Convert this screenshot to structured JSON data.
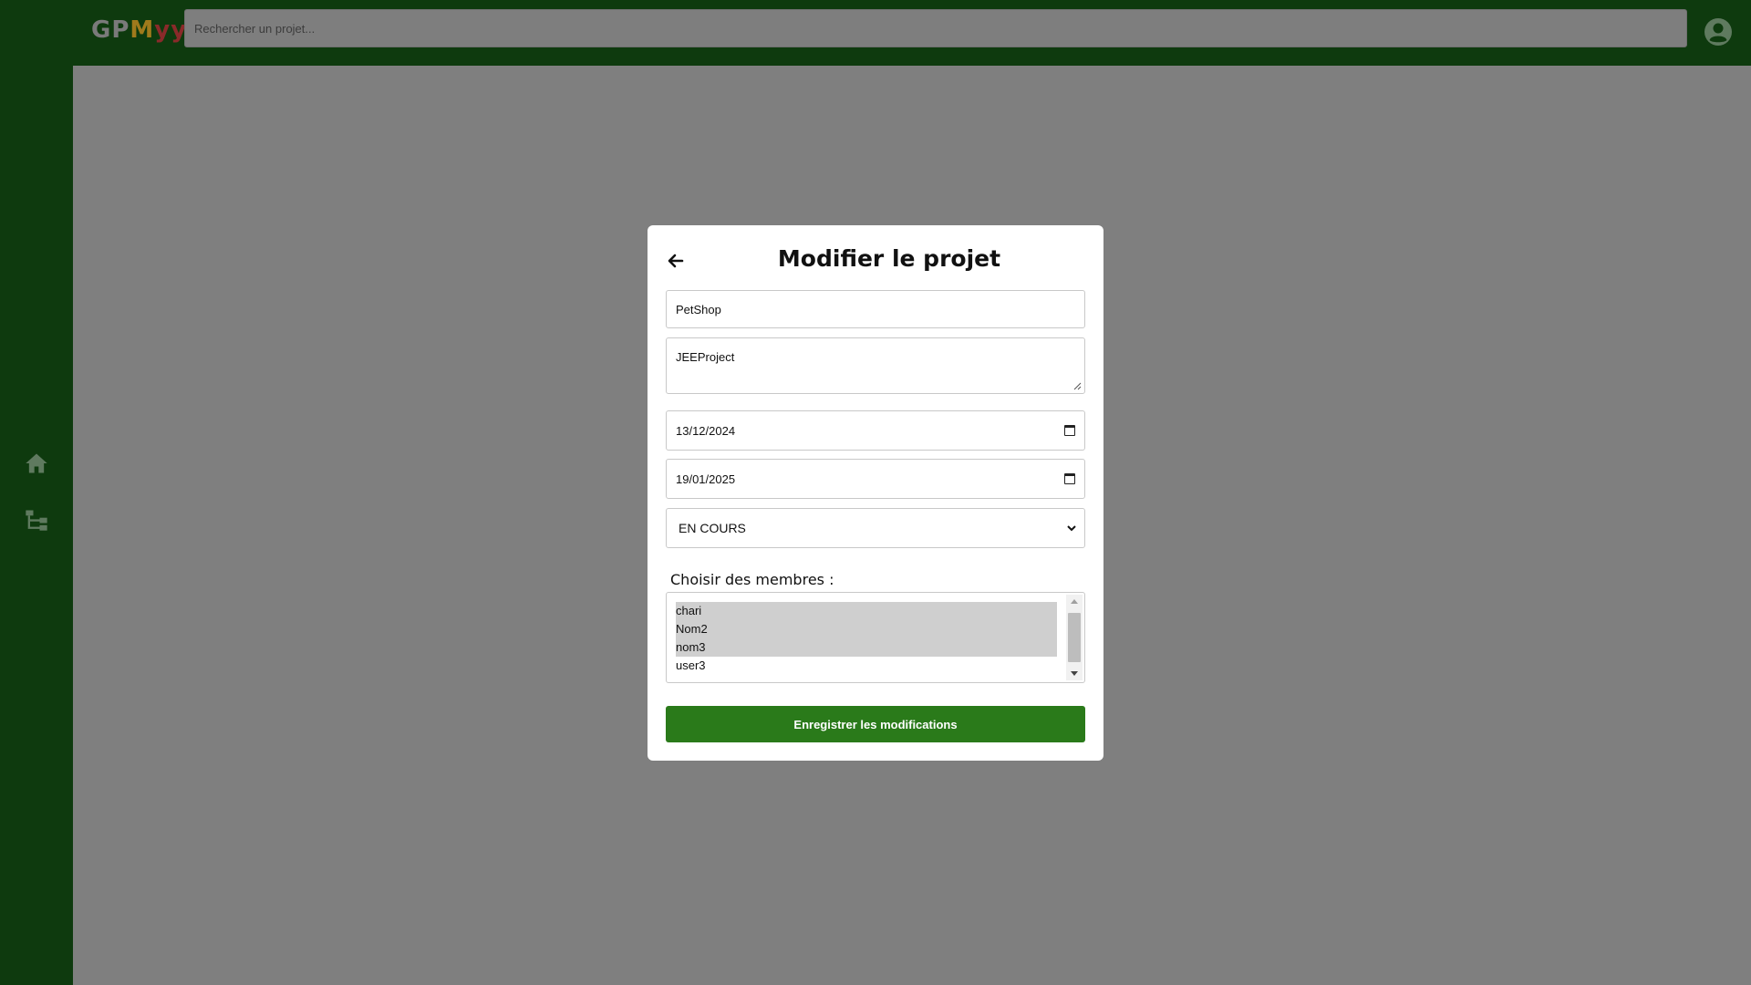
{
  "app": {
    "logo": {
      "part1": "GP",
      "part2": "M",
      "part3": "yy"
    },
    "search": {
      "placeholder": "Rechercher un projet..."
    },
    "colors": {
      "sidebar": "#0e3a0e",
      "accent": "#2a7a1a",
      "overlay": "#808080"
    }
  },
  "sidebar": {
    "items": [
      {
        "icon": "home-icon"
      },
      {
        "icon": "sitemap-icon"
      }
    ]
  },
  "modal": {
    "title": "Modifier le projet",
    "back_icon": "arrow-left-icon",
    "fields": {
      "name": "PetShop",
      "description": "JEEProject",
      "start_date": "13/12/2024",
      "end_date": "19/01/2025",
      "status": "EN COURS"
    },
    "members_label": "Choisir des membres :",
    "members": [
      {
        "name": "chari",
        "selected": true
      },
      {
        "name": "Nom2",
        "selected": true
      },
      {
        "name": "nom3",
        "selected": true
      },
      {
        "name": "user3",
        "selected": false
      }
    ],
    "submit_label": "Enregistrer les modifications"
  }
}
